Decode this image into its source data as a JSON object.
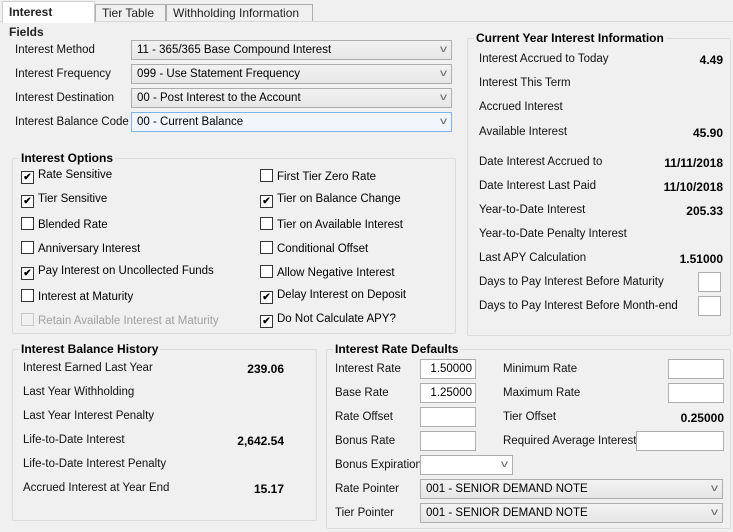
{
  "tabs": [
    {
      "label": "Interest Fields",
      "active": true
    },
    {
      "label": "Tier Table",
      "active": false
    },
    {
      "label": "Withholding Information",
      "active": false
    }
  ],
  "top_fields": [
    {
      "label": "Interest Method",
      "value": "11 - 365/365 Base Compound Interest"
    },
    {
      "label": "Interest Frequency",
      "value": "099 - Use Statement Frequency"
    },
    {
      "label": "Interest Destination",
      "value": "00 - Post Interest to the Account"
    },
    {
      "label": "Interest Balance Code",
      "value": "00 - Current Balance"
    }
  ],
  "interest_options": {
    "title": "Interest Options",
    "left": [
      {
        "label": "Rate Sensitive",
        "checked": true
      },
      {
        "label": "Tier Sensitive",
        "checked": true
      },
      {
        "label": "Blended Rate",
        "checked": false
      },
      {
        "label": "Anniversary Interest",
        "checked": false
      },
      {
        "label": "Pay Interest on Uncollected Funds",
        "checked": true
      },
      {
        "label": "Interest at Maturity",
        "checked": false
      },
      {
        "label": "Retain Available Interest at Maturity",
        "checked": false,
        "disabled": true
      }
    ],
    "right": [
      {
        "label": "First Tier Zero Rate",
        "checked": false
      },
      {
        "label": "Tier on Balance Change",
        "checked": true
      },
      {
        "label": "Tier on Available Interest",
        "checked": false
      },
      {
        "label": "Conditional Offset",
        "checked": false
      },
      {
        "label": "Allow Negative Interest",
        "checked": false
      },
      {
        "label": "Delay Interest on Deposit",
        "checked": true
      },
      {
        "label": "Do Not Calculate APY?",
        "checked": true
      }
    ]
  },
  "current_year": {
    "title": "Current Year Interest Information",
    "rows": [
      {
        "label": "Interest Accrued to Today",
        "value": "4.49"
      },
      {
        "label": "Interest This Term",
        "value": ""
      },
      {
        "label": "Accrued Interest",
        "value": ""
      },
      {
        "label": "Available Interest",
        "value": "45.90"
      },
      {
        "label": "Date Interest Accrued to",
        "value": "11/11/2018"
      },
      {
        "label": "Date Interest Last Paid",
        "value": "11/10/2018"
      },
      {
        "label": "Year-to-Date Interest",
        "value": "205.33"
      },
      {
        "label": "Year-to-Date Penalty Interest",
        "value": ""
      },
      {
        "label": "Last APY Calculation",
        "value": "1.51000"
      }
    ],
    "inputs": [
      {
        "label": "Days to Pay Interest Before Maturity",
        "value": ""
      },
      {
        "label": "Days to Pay Interest Before Month-end",
        "value": ""
      }
    ]
  },
  "balance_history": {
    "title": "Interest Balance History",
    "rows": [
      {
        "label": "Interest Earned Last Year",
        "value": "239.06"
      },
      {
        "label": "Last Year Withholding",
        "value": ""
      },
      {
        "label": "Last Year Interest Penalty",
        "value": ""
      },
      {
        "label": "Life-to-Date Interest",
        "value": "2,642.54"
      },
      {
        "label": "Life-to-Date Interest Penalty",
        "value": ""
      },
      {
        "label": "Accrued Interest at Year End",
        "value": "15.17"
      }
    ]
  },
  "rate_defaults": {
    "title": "Interest Rate Defaults",
    "left": [
      {
        "label": "Interest Rate",
        "value": "1.50000"
      },
      {
        "label": "Base Rate",
        "value": "1.25000"
      },
      {
        "label": "Rate Offset",
        "value": ""
      },
      {
        "label": "Bonus Rate",
        "value": ""
      }
    ],
    "right": [
      {
        "label": "Minimum Rate",
        "value": ""
      },
      {
        "label": "Maximum Rate",
        "value": ""
      },
      {
        "label": "Tier Offset",
        "value": "0.25000"
      },
      {
        "label": "Required Average Interest",
        "value": ""
      }
    ],
    "bonus_expiration": {
      "label": "Bonus Expiration",
      "value": ""
    },
    "rate_pointer": {
      "label": "Rate Pointer",
      "value": "001 - SENIOR DEMAND NOTE"
    },
    "tier_pointer": {
      "label": "Tier Pointer",
      "value": "001 - SENIOR DEMAND NOTE"
    }
  },
  "icons": {
    "chevron": "﹀",
    "check": "✔"
  }
}
